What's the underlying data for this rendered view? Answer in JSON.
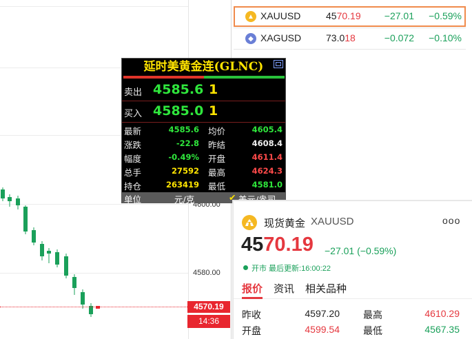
{
  "chart": {
    "y_labels": [
      "4600.00",
      "4580.00"
    ],
    "last_price": "4570.19",
    "last_time": "14:36"
  },
  "watchlist": [
    {
      "symbol": "XAUUSD",
      "price_prefix": "45",
      "price_suffix": "70.19",
      "change": "−27.01",
      "percent": "−0.59%",
      "icon": "gold-coin-icon"
    },
    {
      "symbol": "XAGUSD",
      "price_prefix": "73.0",
      "price_suffix": "18",
      "change": "−0.072",
      "percent": "−0.10%",
      "icon": "silver-coin-icon"
    }
  ],
  "popup": {
    "title": "延时美黄金连(GLNC)",
    "sell_label": "卖出",
    "sell_price": "4585.6",
    "sell_vol": "1",
    "buy_label": "买入",
    "buy_price": "4585.0",
    "buy_vol": "1",
    "rows": [
      {
        "l1": "最新",
        "v1": "4585.6",
        "l2": "均价",
        "v2": "4605.4"
      },
      {
        "l1": "涨跌",
        "v1": "-22.8",
        "l2": "昨结",
        "v2": "4608.4"
      },
      {
        "l1": "幅度",
        "v1": "-0.49%",
        "l2": "开盘",
        "v2": "4611.4"
      },
      {
        "l1": "总手",
        "v1": "27592",
        "l2": "最高",
        "v2": "4624.3"
      },
      {
        "l1": "持仓",
        "v1": "263419",
        "l2": "最低",
        "v2": "4581.0"
      }
    ],
    "unit_label": "单位",
    "unit_cn": "元/克",
    "unit_us": "美元/盎司",
    "check": "✔"
  },
  "card": {
    "name": "现货黄金",
    "symbol": "XAUUSD",
    "more": "ooo",
    "price_prefix": "45",
    "price_suffix": "70.19",
    "change": "−27.01 (−0.59%)",
    "status": "开市  最后更新:16:00:22",
    "tabs": [
      "报价",
      "资讯",
      "相关品种"
    ],
    "stats": [
      {
        "k1": "昨收",
        "v1": "4597.20",
        "k2": "最高",
        "v2": "4610.29"
      },
      {
        "k1": "开盘",
        "v1": "4599.54",
        "k2": "最低",
        "v2": "4567.35"
      }
    ]
  },
  "colors": {
    "up": "#e5383f",
    "down": "#1aa05a",
    "accent": "#f08a4b"
  }
}
